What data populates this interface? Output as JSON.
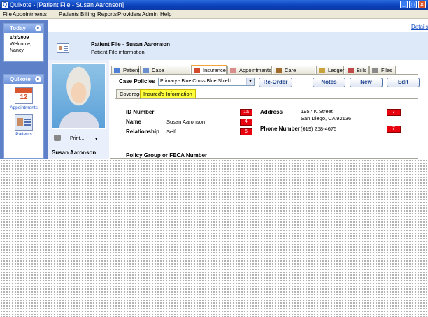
{
  "window": {
    "title": "Quixote - [Patient File - Susan Aaronson]"
  },
  "menu": [
    "File",
    "Appointments",
    "Patients",
    "Billing",
    "Reports",
    "Providers",
    "Admin",
    "Help"
  ],
  "top_link": "Details",
  "today_panel": {
    "header": "Today",
    "date": "1/3/2009",
    "welcome": "Welcome,",
    "user": "Nancy"
  },
  "app_panel": {
    "header": "Quixote",
    "items": [
      {
        "label": "Appointments",
        "icon": "calendar-icon",
        "number": "12"
      },
      {
        "label": "Patients",
        "icon": "patients-icon"
      }
    ]
  },
  "header": {
    "title": "Patient File - Susan Aaronson",
    "subtitle": "Patient File information"
  },
  "patient": {
    "name": "Susan Aaronson",
    "print_label": "Print..."
  },
  "tabs": [
    {
      "label": "Patient",
      "icon_color": "#4f7ed6"
    },
    {
      "label": "Case Information",
      "icon_color": "#6a8fd0"
    },
    {
      "label": "Insurance",
      "icon_color": "#d24a2a"
    },
    {
      "label": "Appointments",
      "icon_color": "#d98c8c"
    },
    {
      "label": "Care Packages",
      "icon_color": "#a06a2a"
    },
    {
      "label": "Ledger",
      "icon_color": "#c8a23a"
    },
    {
      "label": "Bills",
      "icon_color": "#c04a4a"
    },
    {
      "label": "Files",
      "icon_color": "#8a8a8a"
    }
  ],
  "case_policies": {
    "label": "Case Policies",
    "selected": "Primary - Blue Cross Blue Shield"
  },
  "buttons": {
    "reorder": "Re-Order",
    "notes": "Notes",
    "new": "New",
    "edit": "Edit"
  },
  "subtabs": [
    "Coverage",
    "Insured's Information"
  ],
  "insured": {
    "id_label": "ID Number",
    "id_badge": "1a",
    "name_label": "Name",
    "name_value": "Susan Aaronson",
    "name_badge": "4",
    "relationship_label": "Relationship",
    "relationship_value": "Self",
    "relationship_badge": "6",
    "address_label": "Address",
    "address_line1": "1957 K Street",
    "address_line2": "San Diego, CA 92136",
    "address_badge": "7",
    "phone_label": "Phone Number",
    "phone_value": "(619) 258-4675",
    "phone_badge": "7",
    "policy_group_label": "Policy Group or FECA Number"
  }
}
